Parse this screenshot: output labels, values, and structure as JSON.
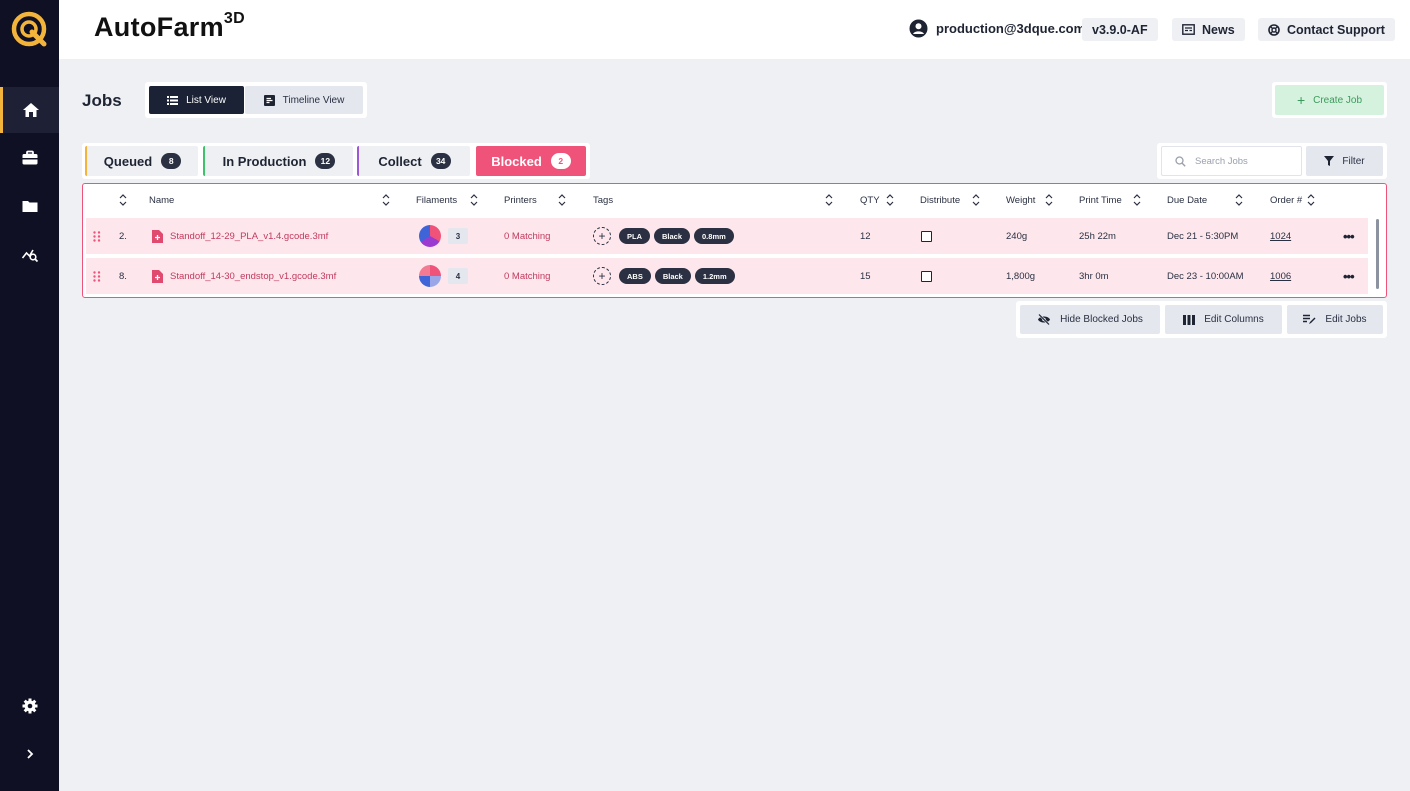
{
  "app": {
    "brand_name": "AutoFarm",
    "brand_suffix": "3D",
    "user_email": "production@3dque.com",
    "version": "v3.9.0-AF",
    "news_label": "News",
    "support_label": "Contact Support",
    "accent_color": "#f3b43c"
  },
  "sidebar": {
    "items": [
      {
        "icon": "home-icon",
        "active": true
      },
      {
        "icon": "briefcase-icon",
        "active": false
      },
      {
        "icon": "folder-icon",
        "active": false
      },
      {
        "icon": "analytics-icon",
        "active": false
      }
    ],
    "bottom": [
      {
        "icon": "gear-icon"
      },
      {
        "icon": "chevron-right-icon"
      }
    ]
  },
  "page": {
    "title": "Jobs",
    "list_view_label": "List View",
    "timeline_view_label": "Timeline View",
    "create_job_label": "Create Job"
  },
  "status_tabs": [
    {
      "label": "Queued",
      "count": "8",
      "color": "#f3b43c"
    },
    {
      "label": "In Production",
      "count": "12",
      "color": "#3fc26b"
    },
    {
      "label": "Collect",
      "count": "34",
      "color": "#9b59d6"
    },
    {
      "label": "Blocked",
      "count": "2",
      "color": "#f0537a"
    }
  ],
  "search": {
    "placeholder": "Search Jobs",
    "filter_label": "Filter"
  },
  "table": {
    "columns": [
      "Name",
      "Filaments",
      "Printers",
      "Tags",
      "QTY",
      "Distribute",
      "Weight",
      "Print Time",
      "Due Date",
      "Order #"
    ],
    "rows": [
      {
        "index": "2.",
        "name": "Standoff_12-29_PLA_v1.4.gcode.3mf",
        "filament_count": "3",
        "printers": "0 Matching",
        "tags": [
          "PLA",
          "Black",
          "0.8mm"
        ],
        "qty": "12",
        "distribute": false,
        "weight": "240g",
        "print_time": "25h 22m",
        "due_date": "Dec 21 - 5:30PM",
        "order": "1024"
      },
      {
        "index": "8.",
        "name": "Standoff_14-30_endstop_v1.gcode.3mf",
        "filament_count": "4",
        "printers": "0 Matching",
        "tags": [
          "ABS",
          "Black",
          "1.2mm"
        ],
        "qty": "15",
        "distribute": false,
        "weight": "1,800g",
        "print_time": "3hr 0m",
        "due_date": "Dec 23 - 10:00AM",
        "order": "1006"
      }
    ]
  },
  "actions": {
    "hide_blocked_label": "Hide Blocked Jobs",
    "edit_columns_label": "Edit Columns",
    "edit_jobs_label": "Edit Jobs"
  }
}
